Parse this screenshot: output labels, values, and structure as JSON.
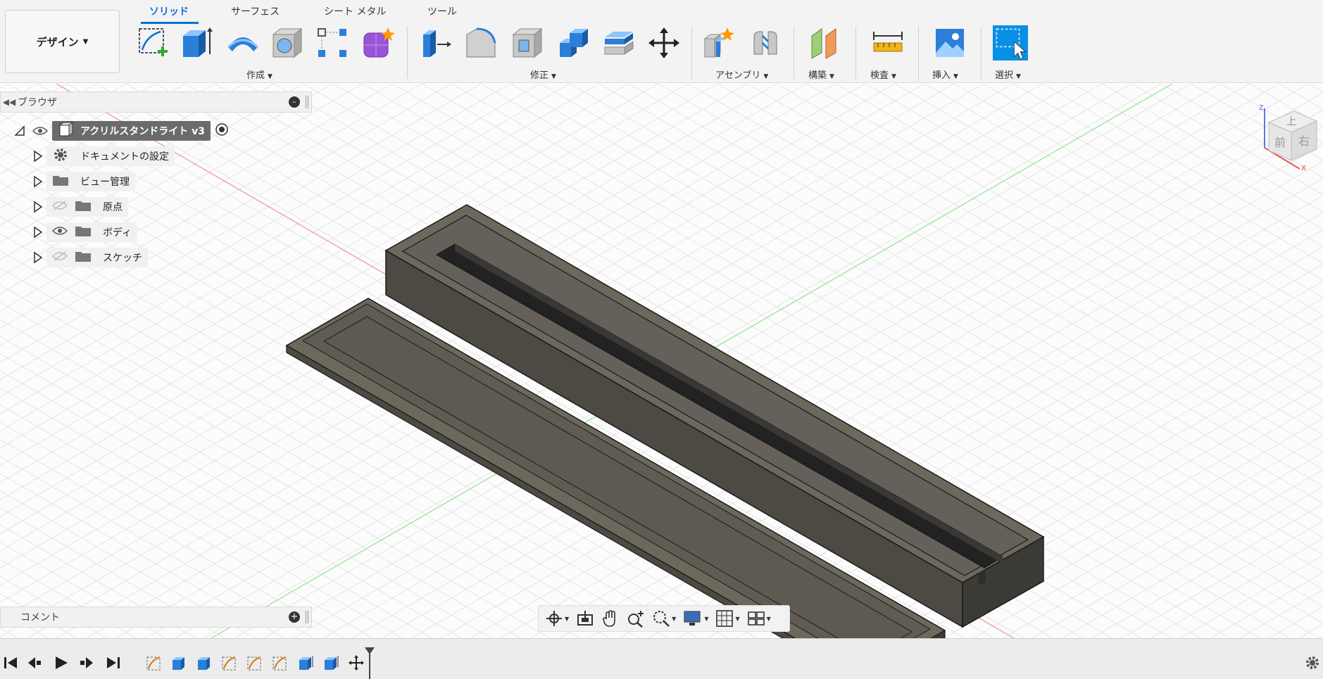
{
  "workspace": {
    "label": "デザイン"
  },
  "tabs": [
    {
      "label": "ソリッド",
      "active": true
    },
    {
      "label": "サーフェス",
      "active": false
    },
    {
      "label": "シート メタル",
      "active": false
    },
    {
      "label": "ツール",
      "active": false
    }
  ],
  "groups": {
    "create": "作成",
    "modify": "修正",
    "assemble": "アセンブリ",
    "construct": "構築",
    "inspect": "検査",
    "insert": "挿入",
    "select": "選択"
  },
  "toolbar_icons": {
    "create": [
      "sketch-icon",
      "extrude-icon",
      "revolve-icon",
      "hole-icon",
      "pattern-icon",
      "form-icon"
    ],
    "modify": [
      "press-pull-icon",
      "fillet-icon",
      "shell-icon",
      "combine-icon",
      "offset-face-icon",
      "move-icon"
    ],
    "assemble": [
      "new-component-icon",
      "joint-icon"
    ],
    "construct": [
      "plane-icon"
    ],
    "inspect": [
      "measure-icon"
    ],
    "insert": [
      "insert-image-icon"
    ],
    "select": [
      "select-icon"
    ]
  },
  "browser": {
    "title": "ブラウザ",
    "root": {
      "label": "アクリルスタンドライト v3"
    },
    "items": [
      {
        "label": "ドキュメントの設定",
        "icon": "gear-icon"
      },
      {
        "label": "ビュー管理",
        "icon": "folder-icon"
      },
      {
        "label": "原点",
        "icon": "folder-icon",
        "visible": false
      },
      {
        "label": "ボディ",
        "icon": "folder-icon",
        "visible": true
      },
      {
        "label": "スケッチ",
        "icon": "folder-icon",
        "visible": false
      }
    ]
  },
  "comments": {
    "title": "コメント"
  },
  "viewcube": {
    "top": "上",
    "front": "前",
    "right": "右",
    "axis_x": "x",
    "axis_z": "z"
  },
  "colors": {
    "accent": "#0a6fd6",
    "body_top": "#6f6a5e",
    "body_side": "#4a4741",
    "grid": "#e2e2e2",
    "axis_red": "#f0a0a0",
    "axis_green": "#9fe39f"
  },
  "timeline": {
    "controls": [
      "first-icon",
      "prev-icon",
      "play-icon",
      "next-icon",
      "last-icon"
    ],
    "features": [
      "sketch",
      "extrude",
      "extrude",
      "sketch",
      "sketch",
      "sketch",
      "extrude",
      "extrude",
      "move"
    ]
  }
}
